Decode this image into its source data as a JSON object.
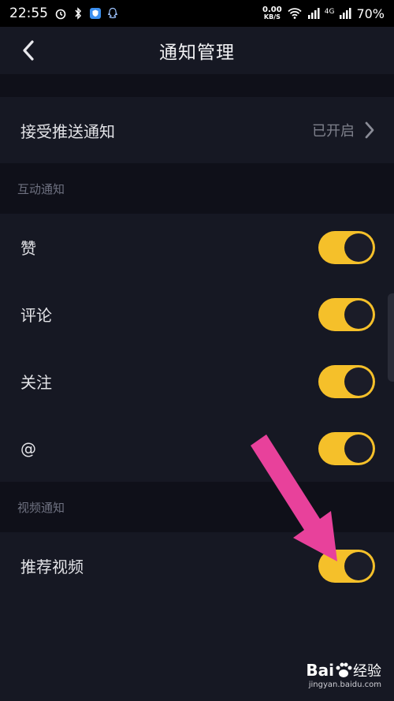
{
  "status_bar": {
    "time": "22:55",
    "speed_value": "0.00",
    "speed_unit": "KB/S",
    "network": "4G",
    "battery": "70%"
  },
  "header": {
    "title": "通知管理"
  },
  "push": {
    "label": "接受推送通知",
    "value": "已开启"
  },
  "sections": {
    "interaction_title": "互动通知",
    "video_title": "视频通知"
  },
  "interaction_items": [
    {
      "label": "赞",
      "enabled": true
    },
    {
      "label": "评论",
      "enabled": true
    },
    {
      "label": "关注",
      "enabled": true
    },
    {
      "label": "@",
      "enabled": true
    }
  ],
  "video_items": [
    {
      "label": "推荐视频",
      "enabled": true
    }
  ],
  "colors": {
    "background": "#161823",
    "section_bg": "#0f1019",
    "toggle_on": "#f5c02a",
    "annotation_arrow": "#e8419b"
  },
  "watermark": {
    "brand": "Bai",
    "brand_suffix": "经验",
    "url": "jingyan.baidu.com"
  }
}
